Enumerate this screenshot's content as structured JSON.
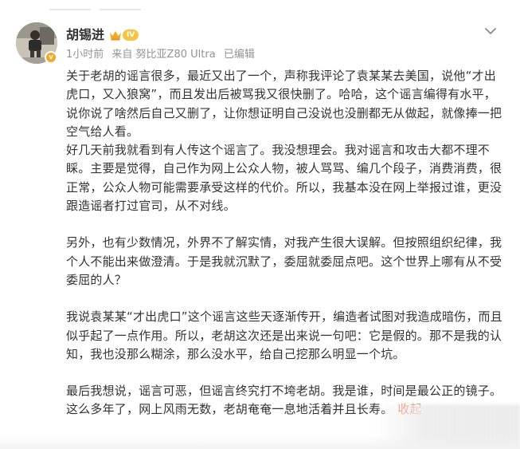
{
  "author": {
    "name": "胡锡进",
    "level_badge": "IV",
    "verified_mark": "v"
  },
  "meta": {
    "time": "1小时前",
    "source": "来自 努比亚Z80 Ultra",
    "edited": "已编辑"
  },
  "post": {
    "paragraphs": [
      "关于老胡的谣言很多，最近又出了一个，声称我评论了袁某某去美国，说他“才出虎口，又入狼窝”，而且发出后被骂我又很快删了。哈哈，这个谣言编得有水平，说你说了啥然后自己又删了，让你想证明自己没说也没删都无从做起，就像捧一把空气给人看。",
      "好几天前我就看到有人传这个谣言了。我没想理会。我对谣言和攻击大都不理不睬。主要是觉得，自己作为网上公众人物，被人骂骂、编几个段子，消费消费，很正常，公众人物可能需要承受这样的代价。所以，我基本没在网上举报过谁，更没跟造谣者打过官司，从不对线。",
      "另外，也有少数情况，外界不了解实情，对我产生很大误解。但按照组织纪律，我个人不能出来做澄清。于是我就沉默了，委屈就委屈点吧。这个世界上哪有从不受委屈的人？",
      "我说袁某某“才出虎口”这个谣言这些天逐渐传开，编造者试图对我造成暗伤，而且似乎起了一点作用。所以，老胡这次还是出来说一句吧：它是假的。那不是我的认知，我也没那么糊涂，那么没水平，给自己挖那么明显一个坑。",
      "最后我想说，谣言可恶，但谣言终究打不垮老胡。我是谁，时间是最公正的镜子。这么多年了，网上风雨无数，老胡奄奄一息地活着并且长寿。"
    ],
    "collapse_label": "收起"
  },
  "icons": {
    "menu": "chevron-down-icon",
    "crown": "crown-icon",
    "verified": "verified-badge-icon"
  },
  "colors": {
    "text": "#333333",
    "meta": "#939393",
    "link": "#eb7350",
    "badge": "#f6c343",
    "verified": "#f5a623"
  }
}
